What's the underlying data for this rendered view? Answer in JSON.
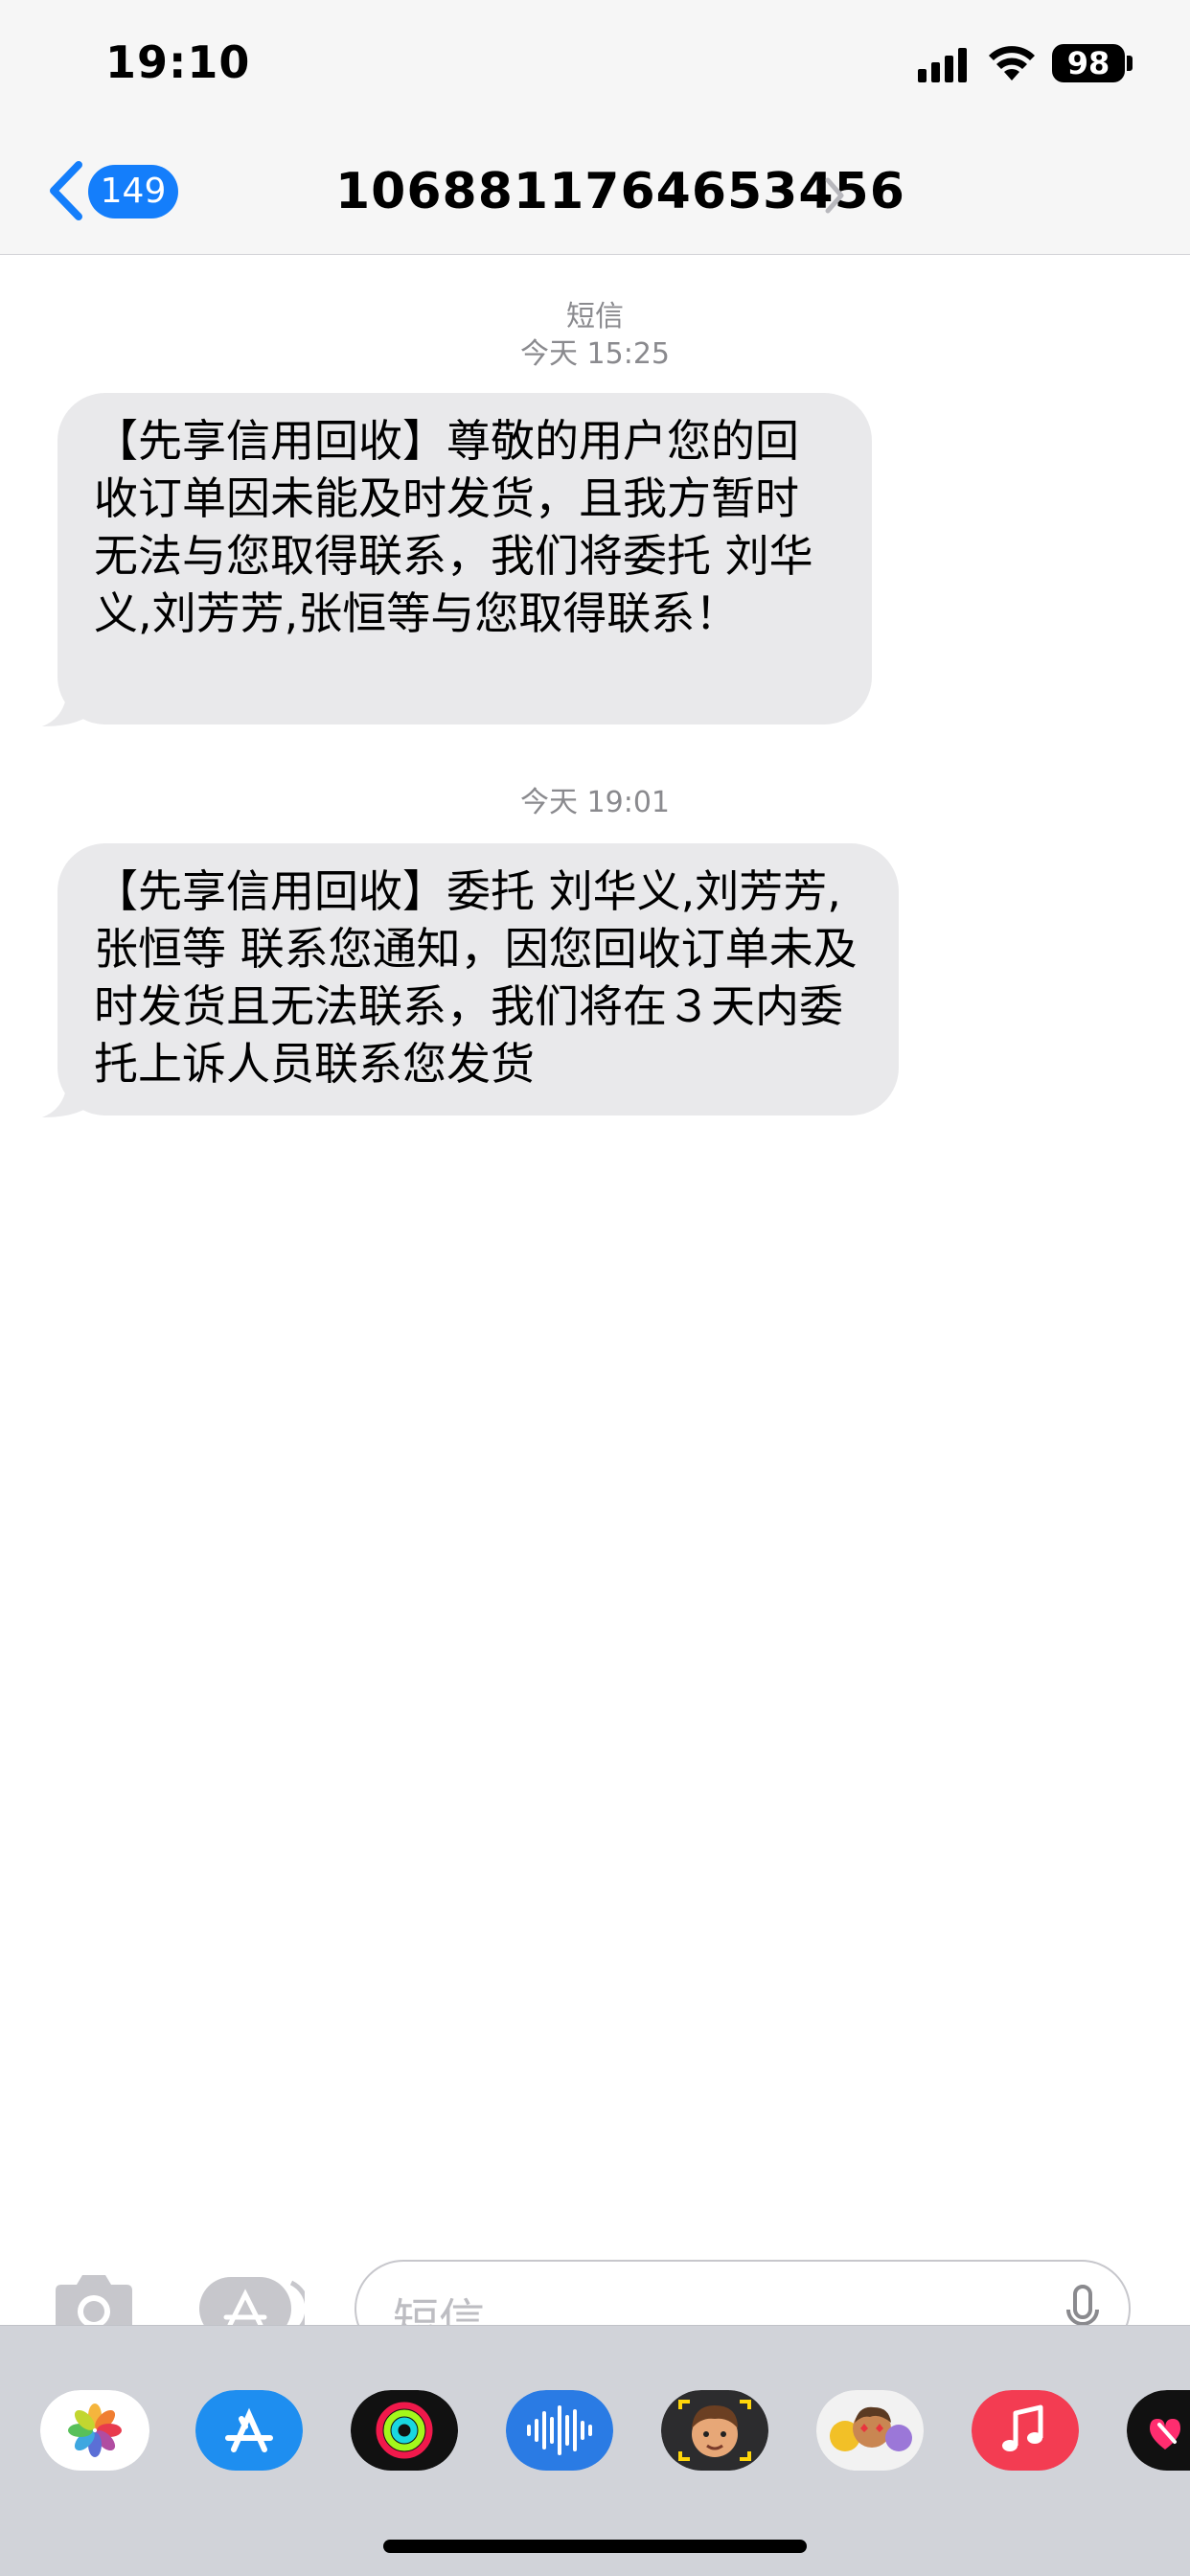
{
  "status_bar": {
    "time": "19:10",
    "battery": "98"
  },
  "nav": {
    "back_count": "149",
    "title": "1068811764653456"
  },
  "conversation": {
    "service_label": "短信",
    "messages": [
      {
        "timestamp": "今天 15:25",
        "text": "【先享信用回收】尊敬的用户您的回收订单因未能及时发货，且我方暂时无法与您取得联系，我们将委托 刘华义,刘芳芳,张恒等与您取得联系！"
      },
      {
        "timestamp": "今天 19:01",
        "text": "【先享信用回收】委托 刘华义,刘芳芳,张恒等 联系您通知，因您回收订单未及时发货且无法联系，我们将在３天内委托上诉人员联系您发货"
      }
    ]
  },
  "input": {
    "placeholder": "短信"
  },
  "app_drawer": {
    "apps": [
      "photos-icon",
      "app-store-icon",
      "fitness-icon",
      "audio-message-icon",
      "memoji-icon",
      "animoji-icon",
      "music-icon",
      "digital-touch-icon"
    ]
  },
  "colors": {
    "accent": "#147efb",
    "bubble": "#e9e9eb",
    "timestamp": "#8a8a8e"
  }
}
